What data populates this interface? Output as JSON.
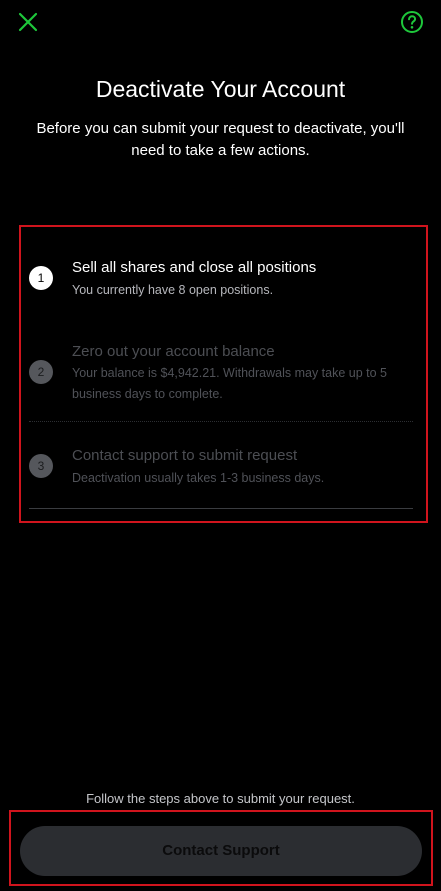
{
  "header": {
    "close_icon": "close-icon",
    "help_icon": "help-circle-icon",
    "accent_color": "#1ec73b"
  },
  "title": "Deactivate Your Account",
  "subtitle": "Before you can submit your request to deactivate, you'll need to take a few actions.",
  "steps": [
    {
      "number": "1",
      "title": "Sell all shares and close all positions",
      "description": "You currently have 8 open positions.",
      "state": "active"
    },
    {
      "number": "2",
      "title": "Zero out your account balance",
      "description": "Your balance is $4,942.21. Withdrawals may take up to 5 business days to complete.",
      "state": "inactive"
    },
    {
      "number": "3",
      "title": "Contact support to submit request",
      "description": "Deactivation usually takes 1-3 business days.",
      "state": "inactive"
    }
  ],
  "footer": {
    "instruction": "Follow the steps above to submit your request.",
    "button_label": "Contact Support"
  },
  "highlight_color": "#d0141d"
}
